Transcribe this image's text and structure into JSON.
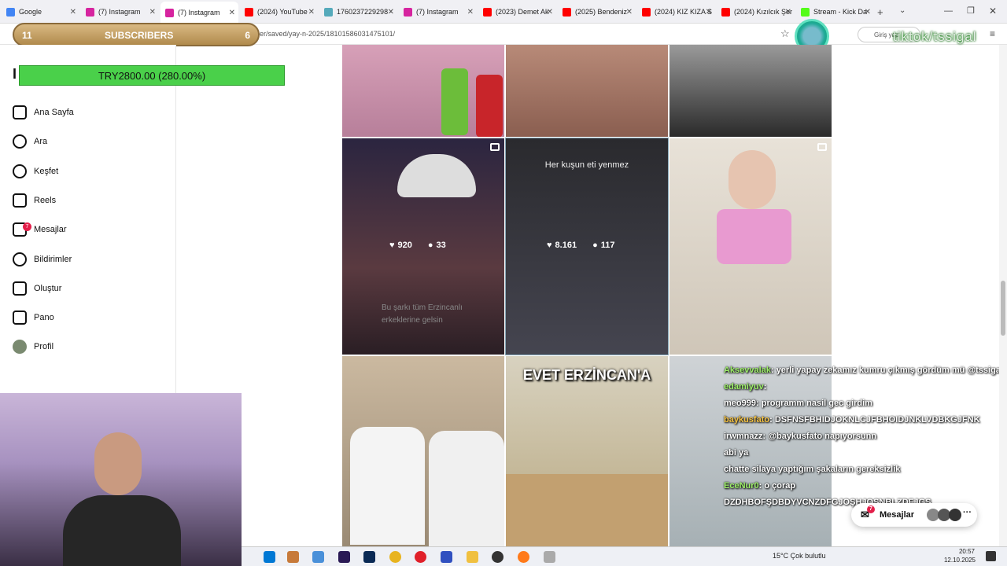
{
  "tabs": [
    {
      "label": "Google",
      "color": "#4285f4"
    },
    {
      "label": "(7) Instagram",
      "color": "#d6249f"
    },
    {
      "label": "(7) Instagram",
      "color": "#d6249f"
    },
    {
      "label": "(2024) YouTube",
      "color": "#ff0000"
    },
    {
      "label": "1760237229298 -",
      "color": "#5ab"
    },
    {
      "label": "(7) Instagram",
      "color": "#d6249f"
    },
    {
      "label": "(2023) Demet Ak",
      "color": "#ff0000"
    },
    {
      "label": "(2025) Bendeniz",
      "color": "#ff0000"
    },
    {
      "label": "(2024) KIZ KIZA S",
      "color": "#ff0000"
    },
    {
      "label": "(2024) Kızılcık Şer",
      "color": "#ff0000"
    },
    {
      "label": "Stream - Kick Da",
      "color": "#53fc18"
    }
  ],
  "address": {
    "url": "er/saved/yay-n-2025/18101586031475101/"
  },
  "overlay": {
    "sub_left": "11",
    "sub_title": "SUBSCRIBERS",
    "sub_right": "6",
    "goal_text": "TRY2800.00 (280.00%)",
    "watermark": "tiktok/tssigal",
    "login_label": "Giriş yap"
  },
  "sidebar": {
    "items": [
      {
        "label": "Ana Sayfa",
        "icon": "home-icon"
      },
      {
        "label": "Ara",
        "icon": "search-icon"
      },
      {
        "label": "Keşfet",
        "icon": "compass-icon"
      },
      {
        "label": "Reels",
        "icon": "reels-icon"
      },
      {
        "label": "Mesajlar",
        "icon": "messenger-icon",
        "badge": "7"
      },
      {
        "label": "Bildirimler",
        "icon": "heart-icon"
      },
      {
        "label": "Oluştur",
        "icon": "plus-icon"
      },
      {
        "label": "Pano",
        "icon": "chart-icon"
      },
      {
        "label": "Profil",
        "icon": "avatar-icon"
      }
    ]
  },
  "grid": {
    "posts": [
      {
        "likes": "920",
        "comments": "33"
      },
      {
        "likes": "8.161",
        "comments": "117",
        "caption": "Her kuşun eti yenmez"
      },
      {
        "caption": "EVET ERZİNCAN'A"
      }
    ],
    "overlay_text": "Bu şarkı tüm Erzincanlı erkeklerine gelsin"
  },
  "chat": {
    "lines": [
      {
        "user": "Aksevvalak",
        "msg": "yerli yapay zekamız kumru çıkmış gördüm mü @tssigalkoo",
        "color": "#9ef06a"
      },
      {
        "user": "edamiyuv",
        "msg": "",
        "color": "#9ef06a"
      },
      {
        "user": "meo999",
        "msg": "programm nasil gec girdim",
        "color": "#ffffff"
      },
      {
        "user": "baykusfato",
        "msg": "DSFNSFBHIDJOKNLCJFBHOIDJNKLVDBKGJFNK",
        "color": "#f5c242"
      },
      {
        "user": "irwmnazz",
        "msg": "@baykusfato napıyorsunn",
        "color": "#ffffff"
      },
      {
        "user": "",
        "msg": "abi ya",
        "color": "#ff5a5a"
      },
      {
        "user": "",
        "msg": "chatte silaya yaptığım şakaların gereksizlik",
        "color": "#6ab0ff"
      },
      {
        "user": "EceNur0",
        "msg": "o çorap",
        "color": "#9ef06a"
      },
      {
        "user": "",
        "msg": "DZDHBOFŞDBDYVCNZDFGJOŞHJOŞNBLZDFJGŞ",
        "color": "#ffffff"
      }
    ]
  },
  "messages_pill": {
    "label": "Mesajlar",
    "badge": "7"
  },
  "taskbar": {
    "weather": "15°C  Çok bulutlu",
    "time": "20:57",
    "date": "12.10.2025"
  }
}
